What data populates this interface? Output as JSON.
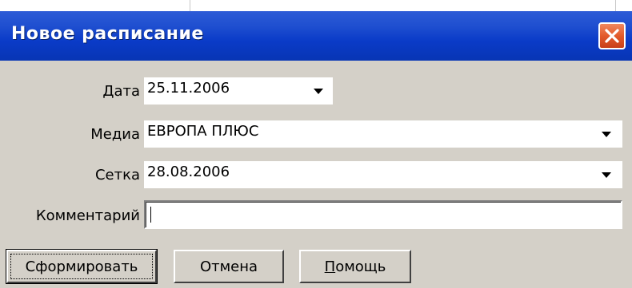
{
  "window": {
    "title": "Новое расписание"
  },
  "form": {
    "date": {
      "label": "Дата",
      "value": "25.11.2006"
    },
    "media": {
      "label": "Медиа",
      "value": "ЕВРОПА ПЛЮС"
    },
    "grid": {
      "label": "Сетка",
      "value": "28.08.2006"
    },
    "comment": {
      "label": "Комментарий",
      "value": ""
    }
  },
  "buttons": {
    "generate": "Сформировать",
    "cancel": "Отмена",
    "help_first": "П",
    "help_rest": "омощь"
  },
  "icons": {
    "close": "close-icon",
    "dropdown": "chevron-down-icon"
  },
  "colors": {
    "titlebar": "#0a3bc8",
    "dialog_bg": "#d4d0c8",
    "close_button": "#e35a2b"
  }
}
